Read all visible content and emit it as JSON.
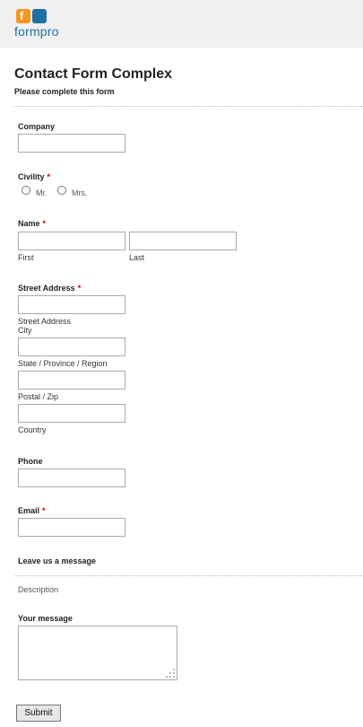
{
  "brand": {
    "name": "formpro"
  },
  "form": {
    "title": "Contact Form Complex",
    "subtitle": "Please complete this form",
    "required_mark": "*"
  },
  "fields": {
    "company": {
      "label": "Company",
      "value": ""
    },
    "civility": {
      "label": "Civility",
      "options": [
        "Mr.",
        "Mrs."
      ]
    },
    "name": {
      "label": "Name",
      "first_sub": "First",
      "last_sub": "Last"
    },
    "address": {
      "label": "Street Address",
      "street_sub": "Street Address",
      "city_sub": "City",
      "state_sub": "State / Province / Region",
      "postal_sub": "Postal / Zip",
      "country_sub": "Country"
    },
    "phone": {
      "label": "Phone"
    },
    "email": {
      "label": "Email"
    },
    "message_section": {
      "title": "Leave us a message",
      "description": "Description"
    },
    "message": {
      "label": "Your message"
    }
  },
  "submit_label": "Submit",
  "colors": {
    "required": "#cc0000",
    "brand_orange": "#f5961e",
    "brand_blue": "#1f6fa3",
    "header_bg": "#f0f0f0"
  }
}
